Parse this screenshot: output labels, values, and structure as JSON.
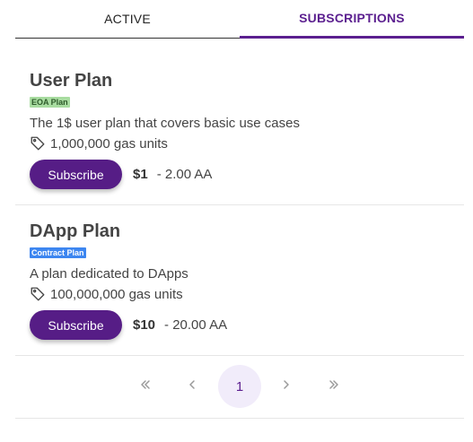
{
  "tabs": {
    "active_label": "ACTIVE",
    "subscriptions_label": "SUBSCRIPTIONS"
  },
  "colors": {
    "accent": "#5b1f8f",
    "button": "#561d86",
    "eoa_badge_bg": "#a8dca0",
    "contract_badge_bg": "#3d86f0"
  },
  "plans": [
    {
      "title": "User Plan",
      "badge": "EOA Plan",
      "description": "The 1$ user plan that covers basic use cases",
      "gas": "1,000,000 gas units",
      "gas_icon": "tag-icon",
      "button_label": "Subscribe",
      "price": "$1",
      "price_aa": "- 2.00 AA"
    },
    {
      "title": "DApp Plan",
      "badge": "Contract Plan",
      "description": "A plan dedicated to DApps",
      "gas": "100,000,000 gas units",
      "gas_icon": "tag-icon",
      "button_label": "Subscribe",
      "price": "$10",
      "price_aa": "- 20.00 AA"
    }
  ],
  "pagination": {
    "current_page": "1",
    "first_icon": "double-chevron-left-icon",
    "prev_icon": "chevron-left-icon",
    "next_icon": "chevron-right-icon",
    "last_icon": "double-chevron-right-icon"
  }
}
